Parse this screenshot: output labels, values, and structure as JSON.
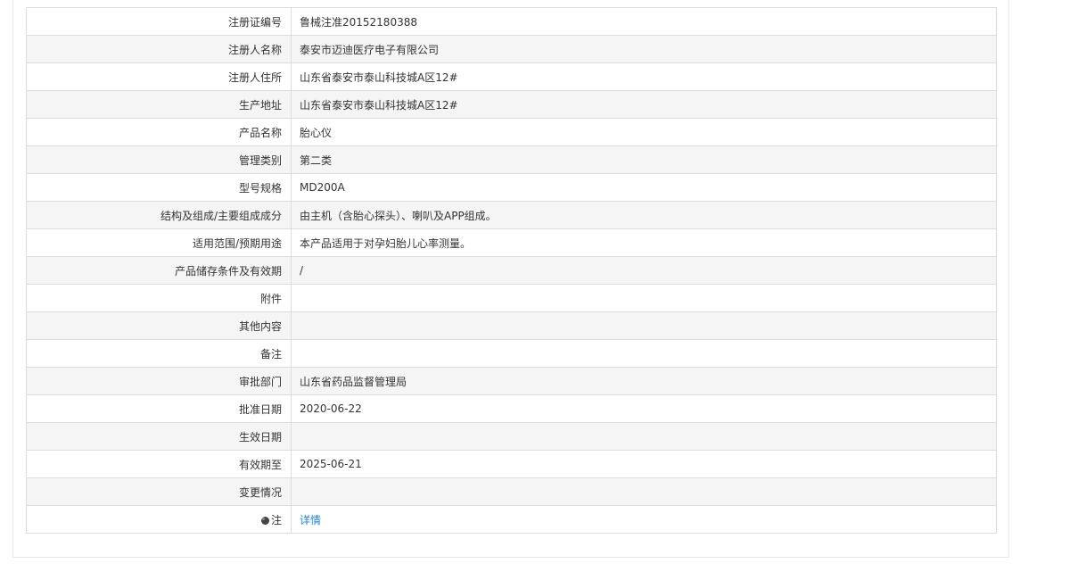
{
  "rows": [
    {
      "label": "注册证编号",
      "value": "鲁械注准20152180388"
    },
    {
      "label": "注册人名称",
      "value": "泰安市迈迪医疗电子有限公司"
    },
    {
      "label": "注册人住所",
      "value": "山东省泰安市泰山科技城A区12#"
    },
    {
      "label": "生产地址",
      "value": "山东省泰安市泰山科技城A区12#"
    },
    {
      "label": "产品名称",
      "value": "胎心仪"
    },
    {
      "label": "管理类别",
      "value": "第二类"
    },
    {
      "label": "型号规格",
      "value": "MD200A"
    },
    {
      "label": "结构及组成/主要组成成分",
      "value": "由主机（含胎心探头）、喇叭及APP组成。"
    },
    {
      "label": "适用范围/预期用途",
      "value": "本产品适用于对孕妇胎儿心率测量。"
    },
    {
      "label": "产品储存条件及有效期",
      "value": "/"
    },
    {
      "label": "附件",
      "value": ""
    },
    {
      "label": "其他内容",
      "value": ""
    },
    {
      "label": "备注",
      "value": ""
    },
    {
      "label": "审批部门",
      "value": "山东省药品监督管理局"
    },
    {
      "label": "批准日期",
      "value": "2020-06-22"
    },
    {
      "label": "生效日期",
      "value": ""
    },
    {
      "label": "有效期至",
      "value": "2025-06-21"
    },
    {
      "label": "变更情况",
      "value": ""
    }
  ],
  "note_row": {
    "icon": "note-icon",
    "label": "注",
    "link_text": "详情"
  },
  "colors": {
    "link": "#2a82c9",
    "row_alt_bg": "#f5f5f5",
    "border": "#dcdcdc"
  }
}
